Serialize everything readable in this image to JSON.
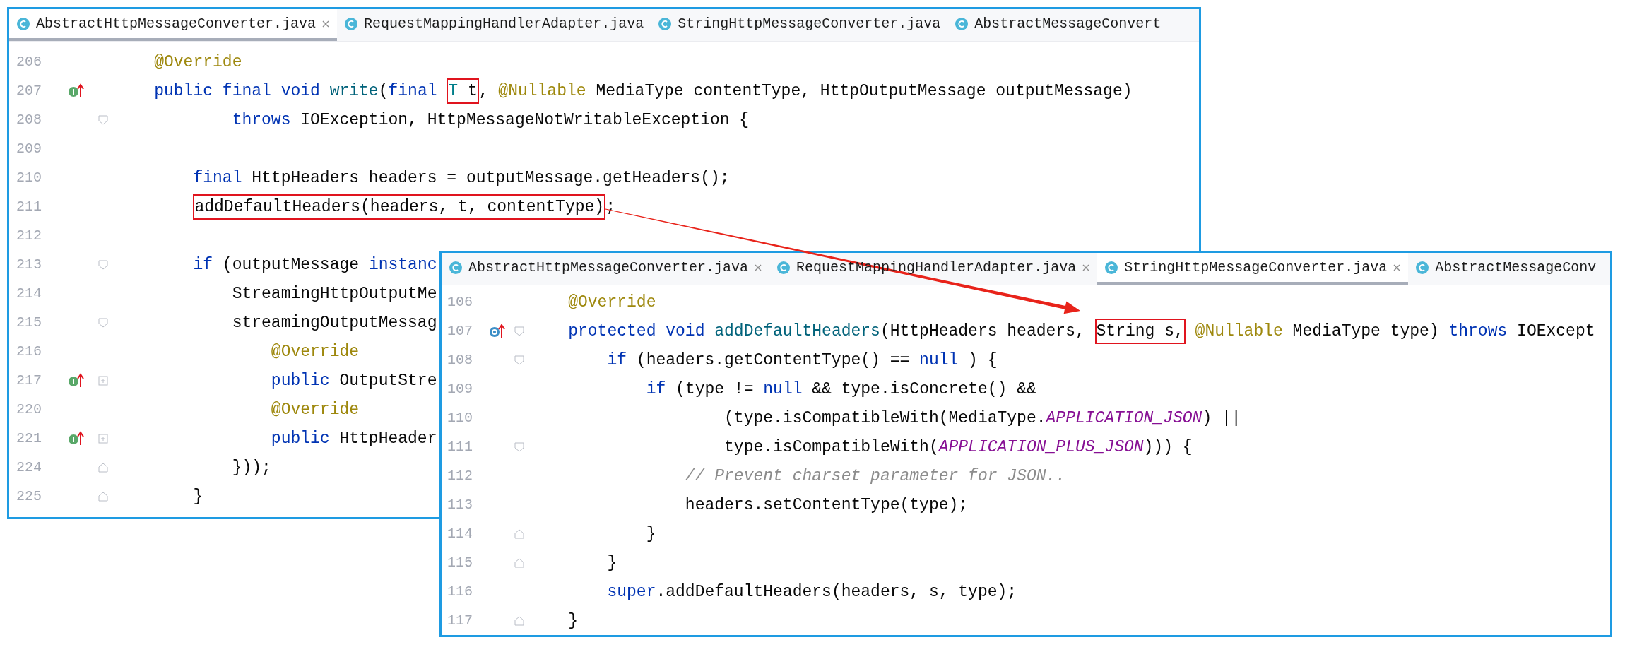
{
  "panels": [
    {
      "tabs": [
        {
          "label": "AbstractHttpMessageConverter.java",
          "selected": true,
          "closable": true
        },
        {
          "label": "RequestMappingHandlerAdapter.java",
          "selected": false,
          "closable": false
        },
        {
          "label": "StringHttpMessageConverter.java",
          "selected": false,
          "closable": false
        },
        {
          "label": "AbstractMessageConvert",
          "selected": false,
          "closable": false
        }
      ],
      "lines": [
        {
          "number": "206",
          "code": [
            {
              "kind": "ann",
              "text": "    @Override"
            }
          ]
        },
        {
          "number": "207",
          "markers": [
            {
              "kind": "implements"
            }
          ],
          "code": [
            {
              "kind": "kw",
              "text": "    public final void "
            },
            {
              "kind": "fn",
              "text": "write"
            },
            {
              "kind": "plain",
              "text": "("
            },
            {
              "kind": "kw",
              "text": "final "
            },
            {
              "kind": "box",
              "parts": [
                {
                  "kind": "typeparam",
                  "text": "T"
                },
                {
                  "kind": "plain",
                  "text": " t"
                }
              ]
            },
            {
              "kind": "plain",
              "text": ", "
            },
            {
              "kind": "ann",
              "text": "@Nullable"
            },
            {
              "kind": "plain",
              "text": " MediaType contentType, HttpOutputMessage outputMessage)"
            }
          ]
        },
        {
          "number": "208",
          "markers": [
            {
              "kind": "fold_start"
            }
          ],
          "code": [
            {
              "kind": "kw",
              "text": "            throws "
            },
            {
              "kind": "plain",
              "text": "IOException, HttpMessageNotWritableException {"
            }
          ]
        },
        {
          "number": "209"
        },
        {
          "number": "210",
          "code": [
            {
              "kind": "kw",
              "text": "        final "
            },
            {
              "kind": "plain",
              "text": "HttpHeaders headers = outputMessage.getHeaders();"
            }
          ]
        },
        {
          "number": "211",
          "code": [
            {
              "kind": "box",
              "parts": [
                {
                  "kind": "plain",
                  "text": "        addDefaultHeaders(headers, t, contentType)"
                }
              ]
            },
            {
              "kind": "plain",
              "text": ";"
            }
          ]
        },
        {
          "number": "212"
        },
        {
          "number": "213",
          "markers": [
            {
              "kind": "fold_start"
            }
          ],
          "code": [
            {
              "kind": "kw",
              "text": "        if "
            },
            {
              "kind": "plain",
              "text": "(outputMessage "
            },
            {
              "kind": "kw",
              "text": "instanc"
            }
          ]
        },
        {
          "number": "214",
          "code": [
            {
              "kind": "plain",
              "text": "            StreamingHttpOutputMe"
            }
          ]
        },
        {
          "number": "215",
          "markers": [
            {
              "kind": "fold_start"
            }
          ],
          "code": [
            {
              "kind": "plain",
              "text": "            streamingOutputMessag"
            }
          ]
        },
        {
          "number": "216",
          "code": [
            {
              "kind": "ann",
              "text": "                @Override"
            }
          ]
        },
        {
          "number": "217",
          "markers": [
            {
              "kind": "implements"
            },
            {
              "kind": "collapsed"
            }
          ],
          "code": [
            {
              "kind": "kw",
              "text": "                public "
            },
            {
              "kind": "plain",
              "text": "OutputStre"
            }
          ]
        },
        {
          "number": "220",
          "code": [
            {
              "kind": "ann",
              "text": "                @Override"
            }
          ]
        },
        {
          "number": "221",
          "markers": [
            {
              "kind": "implements"
            },
            {
              "kind": "collapsed"
            }
          ],
          "code": [
            {
              "kind": "kw",
              "text": "                public "
            },
            {
              "kind": "plain",
              "text": "HttpHeader"
            }
          ]
        },
        {
          "number": "224",
          "markers": [
            {
              "kind": "fold_end"
            }
          ],
          "code": [
            {
              "kind": "plain",
              "text": "            }));"
            }
          ]
        },
        {
          "number": "225",
          "markers": [
            {
              "kind": "fold_end"
            }
          ],
          "code": [
            {
              "kind": "plain",
              "text": "        }"
            }
          ]
        }
      ]
    },
    {
      "tabs": [
        {
          "label": "AbstractHttpMessageConverter.java",
          "selected": false,
          "closable": true
        },
        {
          "label": "RequestMappingHandlerAdapter.java",
          "selected": false,
          "closable": true
        },
        {
          "label": "StringHttpMessageConverter.java",
          "selected": true,
          "closable": true
        },
        {
          "label": "AbstractMessageConv",
          "selected": false,
          "closable": false
        }
      ],
      "lines": [
        {
          "number": "106",
          "code": [
            {
              "kind": "ann",
              "text": "    @Override"
            }
          ]
        },
        {
          "number": "107",
          "markers": [
            {
              "kind": "overrides"
            },
            {
              "kind": "fold_start"
            }
          ],
          "code": [
            {
              "kind": "kw",
              "text": "    protected void "
            },
            {
              "kind": "fn",
              "text": "addDefaultHeaders"
            },
            {
              "kind": "plain",
              "text": "(HttpHeaders headers, "
            },
            {
              "kind": "box",
              "parts": [
                {
                  "kind": "plain",
                  "text": "String s,"
                }
              ]
            },
            {
              "kind": "ann",
              "text": " @Nullable"
            },
            {
              "kind": "plain",
              "text": " MediaType type) "
            },
            {
              "kind": "kw",
              "text": "throws "
            },
            {
              "kind": "plain",
              "text": "IOExcept"
            }
          ]
        },
        {
          "number": "108",
          "markers": [
            {
              "kind": "fold_start"
            }
          ],
          "code": [
            {
              "kind": "kw",
              "text": "        if "
            },
            {
              "kind": "plain",
              "text": "(headers.getContentType() == "
            },
            {
              "kind": "kw",
              "text": "null"
            },
            {
              "kind": "plain",
              "text": " ) {"
            }
          ]
        },
        {
          "number": "109",
          "code": [
            {
              "kind": "kw",
              "text": "            if "
            },
            {
              "kind": "plain",
              "text": "(type != "
            },
            {
              "kind": "kw",
              "text": "null"
            },
            {
              "kind": "plain",
              "text": " && type.isConcrete() &&"
            }
          ]
        },
        {
          "number": "110",
          "code": [
            {
              "kind": "plain",
              "text": "                    (type.isCompatibleWith(MediaType."
            },
            {
              "kind": "const",
              "text": "APPLICATION_JSON"
            },
            {
              "kind": "plain",
              "text": ") ||"
            }
          ]
        },
        {
          "number": "111",
          "markers": [
            {
              "kind": "fold_start"
            }
          ],
          "code": [
            {
              "kind": "plain",
              "text": "                    type.isCompatibleWith("
            },
            {
              "kind": "const",
              "text": "APPLICATION_PLUS_JSON"
            },
            {
              "kind": "plain",
              "text": "))) {"
            }
          ]
        },
        {
          "number": "112",
          "code": [
            {
              "kind": "comment",
              "text": "                // Prevent charset parameter for JSON.."
            }
          ]
        },
        {
          "number": "113",
          "code": [
            {
              "kind": "plain",
              "text": "                headers.setContentType(type);"
            }
          ]
        },
        {
          "number": "114",
          "markers": [
            {
              "kind": "fold_end"
            }
          ],
          "code": [
            {
              "kind": "plain",
              "text": "            }"
            }
          ]
        },
        {
          "number": "115",
          "markers": [
            {
              "kind": "fold_end"
            }
          ],
          "code": [
            {
              "kind": "plain",
              "text": "        }"
            }
          ]
        },
        {
          "number": "116",
          "code": [
            {
              "kind": "kw",
              "text": "        super"
            },
            {
              "kind": "plain",
              "text": ".addDefaultHeaders(headers, s, type);"
            }
          ]
        },
        {
          "number": "117",
          "markers": [
            {
              "kind": "fold_end"
            }
          ],
          "code": [
            {
              "kind": "plain",
              "text": "    }"
            }
          ]
        }
      ]
    }
  ]
}
